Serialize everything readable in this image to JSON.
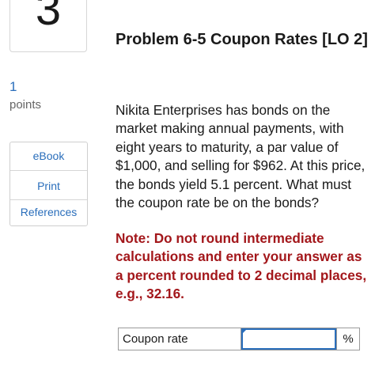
{
  "question": {
    "number": "3",
    "points_value": "1",
    "points_label": "points"
  },
  "resources": {
    "items": [
      {
        "label": "eBook"
      },
      {
        "label": "Print"
      },
      {
        "label": "References"
      }
    ]
  },
  "problem": {
    "title": "Problem 6-5 Coupon Rates [LO 2]",
    "body": "Nikita Enterprises has bonds on the market making annual payments, with eight years to maturity, a par value of $1,000, and selling for $962. At this price, the bonds yield 5.1 percent. What must the coupon rate be on the bonds?",
    "note": "Note: Do not round intermediate calculations and enter your answer as a percent rounded to 2 decimal places, e.g., 32.16."
  },
  "answer": {
    "label": "Coupon rate",
    "value": "",
    "unit": "%"
  },
  "colors": {
    "link": "#2a6ebb",
    "note": "#a3171b",
    "input_border": "#2a6ebb"
  }
}
